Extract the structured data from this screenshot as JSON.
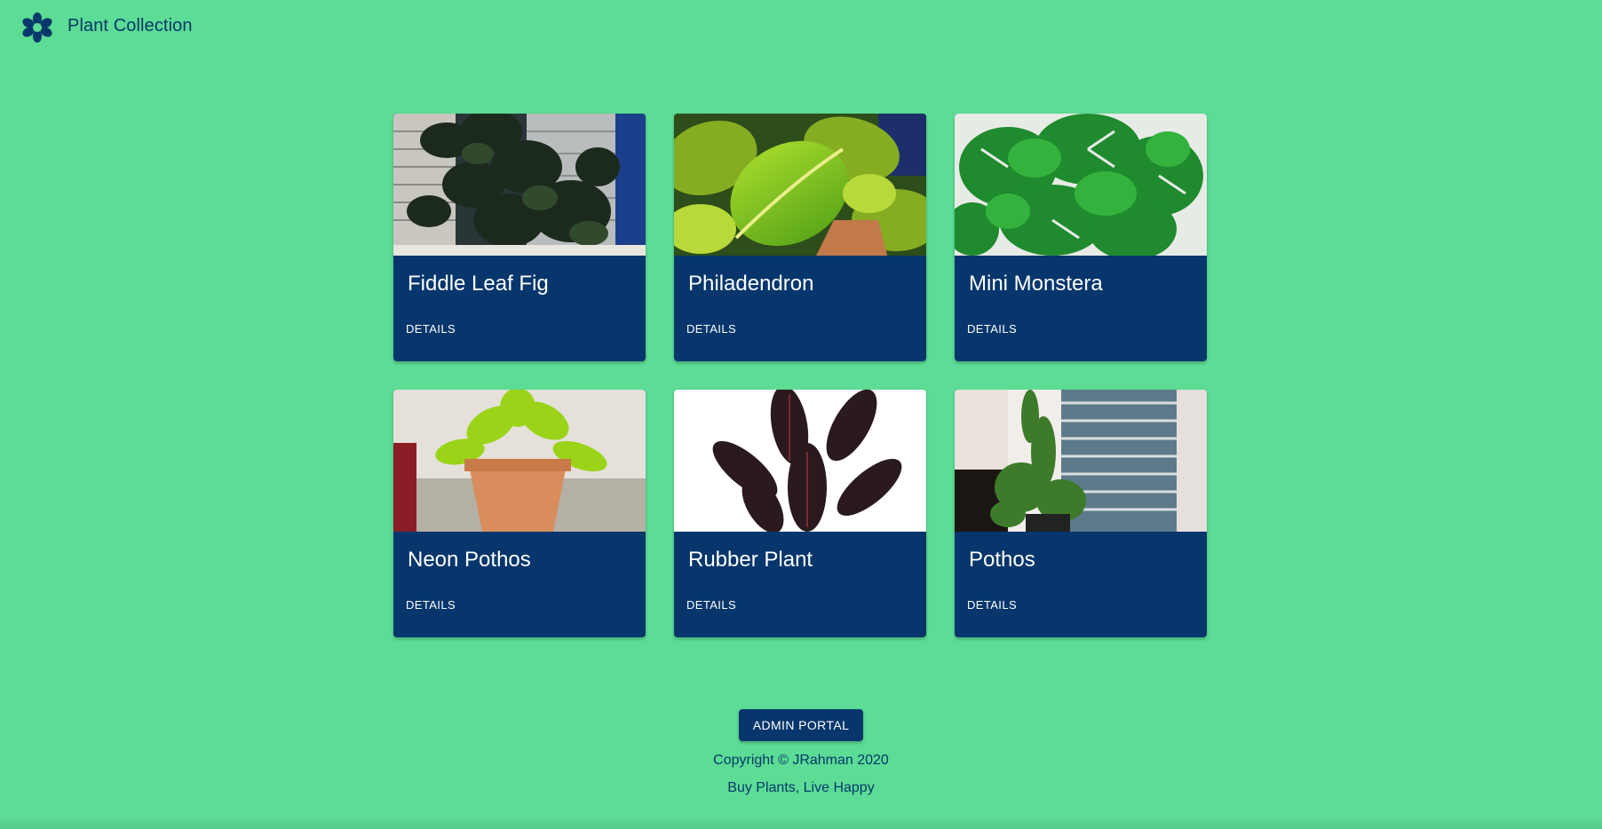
{
  "header": {
    "title": "Plant Collection",
    "logo_icon": "flower-icon"
  },
  "colors": {
    "background": "#5cdc95",
    "primary": "#06366c",
    "text_light": "#ffffff"
  },
  "plants": [
    {
      "name": "Fiddle Leaf Fig",
      "button": "DETAILS"
    },
    {
      "name": "Philadendron",
      "button": "DETAILS"
    },
    {
      "name": "Mini Monstera",
      "button": "DETAILS"
    },
    {
      "name": "Neon Pothos",
      "button": "DETAILS"
    },
    {
      "name": "Rubber Plant",
      "button": "DETAILS"
    },
    {
      "name": "Pothos",
      "button": "DETAILS"
    }
  ],
  "footer": {
    "admin_button": "ADMIN PORTAL",
    "copyright": "Copyright © JRahman 2020",
    "tagline": "Buy Plants, Live Happy"
  }
}
